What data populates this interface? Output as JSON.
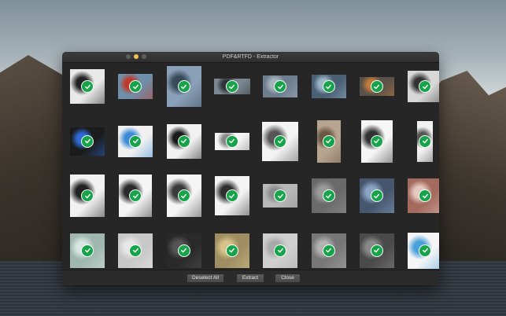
{
  "window": {
    "title": "PDF&RTFD - Extractor"
  },
  "footer": {
    "deselect_label": "Deselect All",
    "extract_label": "Extract",
    "close_label": "Close"
  },
  "colors": {
    "check": "#16a34a",
    "window_bg": "#262626"
  },
  "thumbnails": [
    {
      "subject": "hand-and-device",
      "selected": true,
      "bg": "#e9e9e9",
      "fg": "#222222"
    },
    {
      "subject": "person-red-coat",
      "selected": true,
      "bg": "#6f8ea8",
      "fg": "#c0392b"
    },
    {
      "subject": "field-rows",
      "selected": true,
      "bg": "#8aa0b8",
      "fg": "#394a5a"
    },
    {
      "subject": "aerial-roofs",
      "selected": true,
      "bg": "#7b8791",
      "fg": "#2e3439"
    },
    {
      "subject": "aerial-fields",
      "selected": true,
      "bg": "#6d7e8f",
      "fg": "#a8b3bd"
    },
    {
      "subject": "solar-panels",
      "selected": true,
      "bg": "#4a6075",
      "fg": "#9db4c9"
    },
    {
      "subject": "colorful-parts",
      "selected": true,
      "bg": "#5a5148",
      "fg": "#c07a3b"
    },
    {
      "subject": "laptop",
      "selected": true,
      "bg": "#d8d8d8",
      "fg": "#333333"
    },
    {
      "subject": "monitor-dark",
      "selected": true,
      "bg": "#1b1b1b",
      "fg": "#2e6bd6"
    },
    {
      "subject": "imac",
      "selected": true,
      "bg": "#f0f0f0",
      "fg": "#3a8ad6"
    },
    {
      "subject": "speaker",
      "selected": true,
      "bg": "#f2f2f2",
      "fg": "#1a1a1a"
    },
    {
      "subject": "small-device",
      "selected": true,
      "bg": "#f5f5f5",
      "fg": "#888888"
    },
    {
      "subject": "hands-object",
      "selected": true,
      "bg": "#f3f3f3",
      "fg": "#555555"
    },
    {
      "subject": "phone-board",
      "selected": true,
      "bg": "#b8a58f",
      "fg": "#6a5845"
    },
    {
      "subject": "phone-parts",
      "selected": true,
      "bg": "#f6f6f6",
      "fg": "#333333"
    },
    {
      "subject": "phone-side",
      "selected": true,
      "bg": "#f2f2f2",
      "fg": "#555555"
    },
    {
      "subject": "camera-module",
      "selected": true,
      "bg": "#f2f2f2",
      "fg": "#222222"
    },
    {
      "subject": "circuit-part",
      "selected": true,
      "bg": "#f5f5f5",
      "fg": "#2a2a2a"
    },
    {
      "subject": "battery-board",
      "selected": true,
      "bg": "#f5f5f5",
      "fg": "#3a3a3a"
    },
    {
      "subject": "connector",
      "selected": true,
      "bg": "#f3f3f3",
      "fg": "#2f2f2f"
    },
    {
      "subject": "gray-plate",
      "selected": true,
      "bg": "#b8b8b8",
      "fg": "#8d8d8d"
    },
    {
      "subject": "dark-metal",
      "selected": true,
      "bg": "#6a6a6a",
      "fg": "#9a9a9a"
    },
    {
      "subject": "blue-crystals",
      "selected": true,
      "bg": "#46566e",
      "fg": "#8aa4c4"
    },
    {
      "subject": "red-minerals",
      "selected": true,
      "bg": "#a56a5e",
      "fg": "#e3c9bf"
    },
    {
      "subject": "glass-shards",
      "selected": true,
      "bg": "#9fb7ae",
      "fg": "#d8e6e1"
    },
    {
      "subject": "silver-foil",
      "selected": true,
      "bg": "#c8c8c8",
      "fg": "#e8e8e8"
    },
    {
      "subject": "black-pellets",
      "selected": true,
      "bg": "#2a2a2a",
      "fg": "#555555"
    },
    {
      "subject": "gold-foil",
      "selected": true,
      "bg": "#9e8e62",
      "fg": "#d8c48b"
    },
    {
      "subject": "brushed-metal",
      "selected": true,
      "bg": "#cfcfcf",
      "fg": "#a9a9a9"
    },
    {
      "subject": "metal-scraps",
      "selected": true,
      "bg": "#777777",
      "fg": "#b3b3b3"
    },
    {
      "subject": "wire-scraps",
      "selected": true,
      "bg": "#4a4a4a",
      "fg": "#8a8a8a"
    },
    {
      "subject": "imac-screen",
      "selected": true,
      "bg": "#f5f5f5",
      "fg": "#4aa0d8"
    }
  ]
}
